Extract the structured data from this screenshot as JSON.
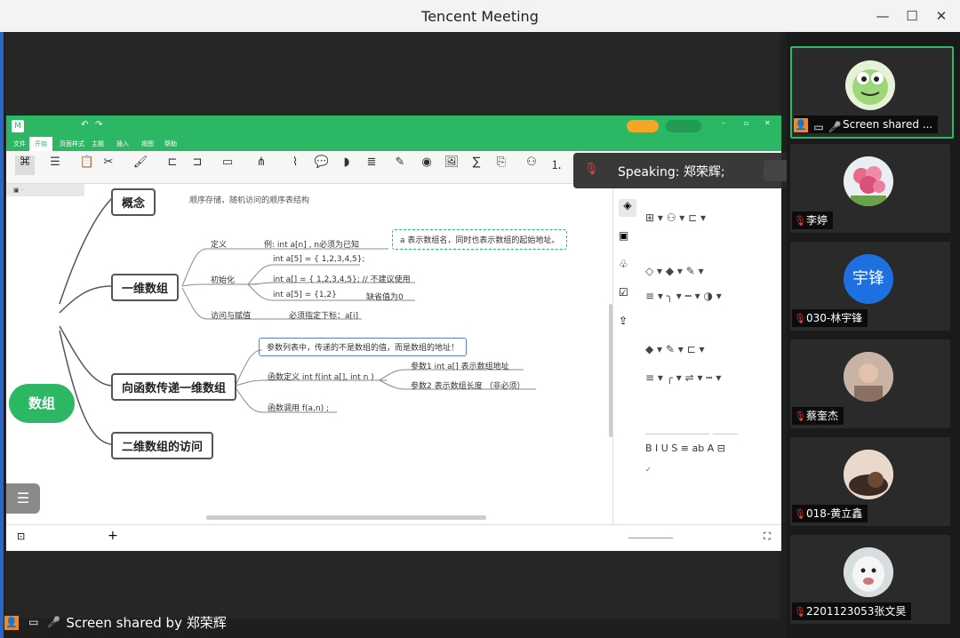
{
  "window": {
    "title": "Tencent Meeting",
    "minimize": "—",
    "maximize": "☐",
    "close": "✕"
  },
  "mindmap": {
    "central": "数组",
    "partial_top": "概念",
    "partial_top_leaf": "顺序存储，随机访问的顺序表结构",
    "branches": {
      "one_dim": "一维数组",
      "pass_fn": "向函数传递一维数组",
      "two_dim": "二维数组的访问"
    },
    "one_dim_children": {
      "define": "定义",
      "define_example": "例:   int a[n] , n必须为已知",
      "define_note": "a 表示数组名，同时也表示数组的起始地址。",
      "init": "初始化",
      "init_1": "int a[5] = { 1,2,3,4,5};",
      "init_2": "int a[] = { 1,2,3,4,5};     // 不建议使用",
      "init_3": "int a[5] = {1,2}",
      "init_3_note": "缺省值为0",
      "access": "访问与赋值",
      "access_note": "必须指定下标：a[i]"
    },
    "pass_children": {
      "param_list": "参数列表中，传递的不是数组的值，而是数组的地址！",
      "fn_def": "函数定义  int f(int a[], int n )",
      "param1": "参数1    int a[]  表示数组地址",
      "param2": "参数2   表示数组长度  （非必须）",
      "fn_call": "函数调用  f(a,n) ;"
    }
  },
  "app_menu": [
    "文件",
    "开始",
    "页面样式",
    "主题",
    "插入",
    "视图",
    "帮助"
  ],
  "speaking": {
    "label": "Speaking: 郑荣辉;"
  },
  "bottom_share": {
    "label": "Screen shared by 郑荣辉"
  },
  "participants": [
    {
      "name": "Screen shared ...",
      "avatar": "frog",
      "active": true
    },
    {
      "name": "李婷",
      "avatar": "flower"
    },
    {
      "name": "030-林宇锋",
      "avatar": "宇锋",
      "avatar_color": "#1e6fe0"
    },
    {
      "name": "蔡奎杰",
      "avatar": "photo"
    },
    {
      "name": "018-黄立鑫",
      "avatar": "cat"
    },
    {
      "name": "2201123053张文昊",
      "avatar": "dog"
    }
  ],
  "colors": {
    "accent": "#2bb764",
    "frame": "#2a66c8",
    "mute": "#e04040"
  }
}
